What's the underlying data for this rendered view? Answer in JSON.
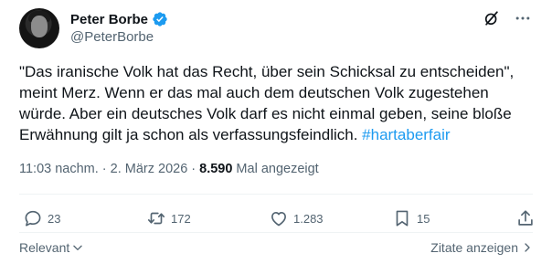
{
  "author": {
    "display_name": "Peter Borbe",
    "handle": "@PeterBorbe",
    "verified": true
  },
  "tweet": {
    "text": "\"Das iranische Volk hat das Recht, über sein Schicksal zu entscheiden\", meint Merz. Wenn er das mal auch dem deutschen Volk zugestehen würde. Aber ein deutsches Volk darf es nicht einmal geben, seine bloße Erwähnung gilt ja schon als verfassungsfeindlich. ",
    "hashtag": "#hartaberfair"
  },
  "meta": {
    "time": "11:03 nachm.",
    "separator": "·",
    "date": "2. März 2026",
    "views_count": "8.590",
    "views_label": "Mal angezeigt"
  },
  "actions": {
    "replies": "23",
    "retweets": "172",
    "likes": "1.283",
    "bookmarks": "15"
  },
  "footer": {
    "relevant_label": "Relevant",
    "quotes_label": "Zitate anzeigen"
  },
  "colors": {
    "text": "#0f1419",
    "secondary": "#536471",
    "accent": "#1d9bf0",
    "divider": "#eff3f4"
  },
  "icons": [
    "verified-badge-icon",
    "grok-icon",
    "more-icon",
    "reply-icon",
    "retweet-icon",
    "like-icon",
    "bookmark-icon",
    "share-icon",
    "chevron-down-icon",
    "chevron-right-icon"
  ]
}
